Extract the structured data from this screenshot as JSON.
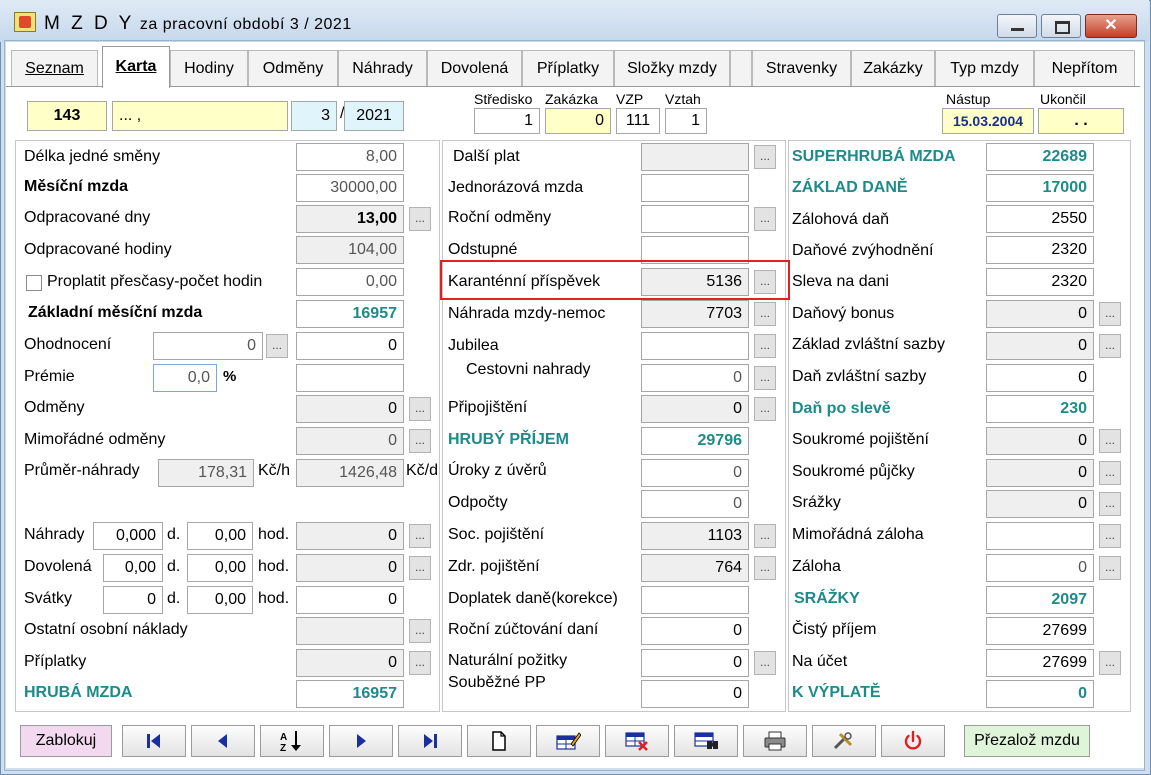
{
  "window": {
    "title_main": "M Z D Y",
    "title_sub": "za pracovní období  3 / 2021",
    "close_glyph": "✕"
  },
  "tabs": [
    {
      "label": "Seznam"
    },
    {
      "label": "Karta"
    },
    {
      "label": "Hodiny"
    },
    {
      "label": "Odměny"
    },
    {
      "label": "Náhrady"
    },
    {
      "label": "Dovolená"
    },
    {
      "label": "Příplatky"
    },
    {
      "label": "Složky mzdy"
    },
    {
      "label": "Stravenky"
    },
    {
      "label": "Zakázky"
    },
    {
      "label": "Typ mzdy"
    },
    {
      "label": "Nepřítom"
    }
  ],
  "header": {
    "emp_number": "143",
    "emp_name": "... ,",
    "month": "3",
    "slash": "/",
    "year": "2021",
    "stredisko_label": "Středisko",
    "stredisko_value": "1",
    "zakazka_label": "Zakázka",
    "zakazka_value": "0",
    "vzp_label": "VZP",
    "vzp_value": "111",
    "vztah_label": "Vztah",
    "vztah_value": "1",
    "nastup_label": "Nástup",
    "nastup_value": "15.03.2004",
    "ukoncil_label": "Ukončil",
    "ukoncil_value": ". ."
  },
  "left": {
    "delka_smeny_label": "Délka jedné směny",
    "delka_smeny_value": "8,00",
    "mesicni_mzda_label": "Měsíční mzda",
    "mesicni_mzda_value": "30000,00",
    "odprac_dny_label": "Odpracované dny",
    "odprac_dny_value": "13,00",
    "odprac_hodiny_label": "Odpracované hodiny",
    "odprac_hodiny_value": "104,00",
    "prescasy_label": "Proplatit přesčasy-počet hodin",
    "prescasy_value": "0,00",
    "zakladni_mzda_label": "Základní měsíční mzda",
    "zakladni_mzda_value": "16957",
    "ohodnoceni_label": "Ohodnocení",
    "ohodnoceni_input": "0",
    "ohodnoceni_value": "0",
    "premie_label": "Prémie",
    "premie_input": "0,0",
    "premie_pct": "%",
    "premie_value": "",
    "odmeny_label": "Odměny",
    "odmeny_value": "0",
    "mimoradne_label": "Mimořádné odměny",
    "mimoradne_value": "0",
    "prumer_label": "Průměr-náhrady",
    "prumer_value": "178,31",
    "kch_unit": "Kč/h",
    "prumer_den": "1426,48",
    "kcd_unit": "Kč/d",
    "nahrady_label": "Náhrady",
    "nahrady_d": "0,000",
    "nahrady_h": "0,00",
    "nahrady_value": "0",
    "dovolena_label": "Dovolená",
    "dovolena_d": "0,00",
    "dovolena_h": "0,00",
    "dovolena_value": "0",
    "svatky_label": "Svátky",
    "svatky_d": "0",
    "svatky_h": "0,00",
    "svatky_value": "0",
    "d_unit": "d.",
    "hod_unit": "hod.",
    "ostatni_label": "Ostatní osobní náklady",
    "ostatni_value": "",
    "priplatky_label": "Příplatky",
    "priplatky_value": "0",
    "hruba_mzda_label": "HRUBÁ MZDA",
    "hruba_mzda_value": "16957"
  },
  "middle": {
    "dalsi_plat_label": "Další plat",
    "dalsi_plat_value": "",
    "jednorazova_label": "Jednorázová mzda",
    "jednorazova_value": "",
    "rocni_odmeny_label": "Roční odměny",
    "rocni_odmeny_value": "",
    "odstupne_label": "Odstupné",
    "odstupne_value": "",
    "karantenni_label": "Karanténní příspěvek",
    "karantenni_value": "5136",
    "nahrada_nemoc_label": "Náhrada mzdy-nemoc",
    "nahrada_nemoc_value": "7703",
    "jubilea_label": "Jubilea",
    "jubilea_value": "",
    "cestovni_label": "Cestovni nahrady",
    "cestovni_value": "0",
    "pripojisteni_label": "Připojištění",
    "pripojisteni_value": "0",
    "hruby_prijem_label": "HRUBÝ PŘÍJEM",
    "hruby_prijem_value": "29796",
    "uroky_label": "Úroky z úvěrů",
    "uroky_value": "0",
    "odpocty_label": "Odpočty",
    "odpocty_value": "0",
    "soc_label": "Soc. pojištění",
    "soc_value": "1103",
    "zdr_label": "Zdr. pojištění",
    "zdr_value": "764",
    "doplatek_label": "Doplatek daně(korekce)",
    "doplatek_value": "",
    "rocni_zuct_label": "Roční zúčtování daní",
    "rocni_zuct_value": "0",
    "naturalni_label": "Naturální požitky",
    "naturalni_value": "0",
    "soubezne_label": "Souběžné PP",
    "soubezne_value": "0"
  },
  "right": {
    "superhruba_label": "SUPERHRUBÁ MZDA",
    "superhruba_value": "22689",
    "zaklad_dane_label": "ZÁKLAD DANĚ",
    "zaklad_dane_value": "17000",
    "zalohova_dan_label": "Zálohová daň",
    "zalohova_dan_value": "2550",
    "danove_zvyh_label": "Daňové zvýhodnění",
    "danove_zvyh_value": "2320",
    "sleva_label": "Sleva na dani",
    "sleva_value": "2320",
    "bonus_label": "Daňový bonus",
    "bonus_value": "0",
    "zaklad_zvl_label": "Základ zvláštní sazby",
    "zaklad_zvl_value": "0",
    "dan_zvl_label": "Daň zvláštní sazby",
    "dan_zvl_value": "0",
    "dan_po_sleve_label": "Daň po slevě",
    "dan_po_sleve_value": "230",
    "souk_poj_label": "Soukromé pojištění",
    "souk_poj_value": "0",
    "souk_pujcky_label": "Soukromé půjčky",
    "souk_pujcky_value": "0",
    "srazky_label": "Srážky",
    "srazky_value": "0",
    "mimoradna_zaloha_label": "Mimořádná záloha",
    "mimoradna_zaloha_value": "",
    "zaloha_label": "Záloha",
    "zaloha_value": "0",
    "srazky_total_label": "SRÁŽKY",
    "srazky_total_value": "2097",
    "cisty_prijem_label": "Čistý příjem",
    "cisty_prijem_value": "27699",
    "na_ucet_label": "Na účet",
    "na_ucet_value": "27699",
    "k_vyplate_label": "K VÝPLATĚ",
    "k_vyplate_value": "0"
  },
  "toolbar": {
    "zablokuj_label": "Zablokuj",
    "prezaloz_label": "Přezalož mzdu"
  },
  "dots_label": "...",
  "colors": {
    "accent_teal": "#1f8a8a",
    "highlight_red": "#e22222",
    "field_yellow": "#ffffc8",
    "field_cyan": "#e0f4fb"
  }
}
